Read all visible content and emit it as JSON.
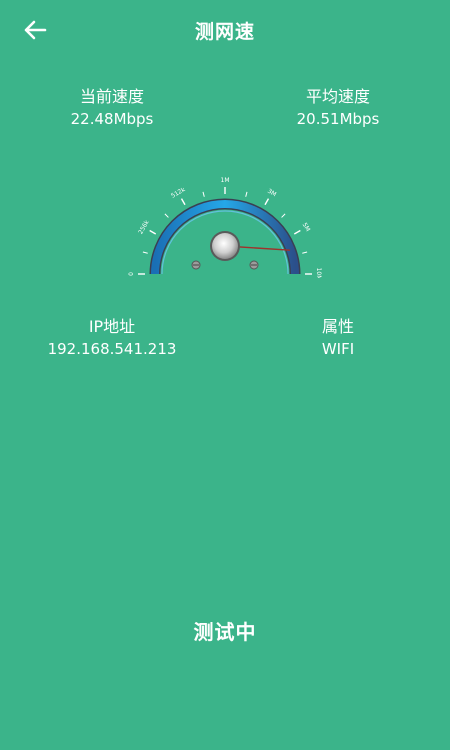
{
  "header": {
    "back_icon": "arrow-left-icon",
    "title": "测网速"
  },
  "stats": {
    "current": {
      "label": "当前速度",
      "value": "22.48Mbps"
    },
    "average": {
      "label": "平均速度",
      "value": "20.51Mbps"
    },
    "ip": {
      "label": "IP地址",
      "value": "192.168.541.213"
    },
    "property": {
      "label": "属性",
      "value": "WIFI"
    }
  },
  "gauge": {
    "tick_labels": [
      "0",
      "256k",
      "512k",
      "1M",
      "3M",
      "5M",
      "10M"
    ],
    "needle_level": 0.88
  },
  "status_text": "测试中",
  "colors": {
    "background": "#3bb48a",
    "gauge_blue": "#1e88d9",
    "needle": "#a0322c"
  }
}
